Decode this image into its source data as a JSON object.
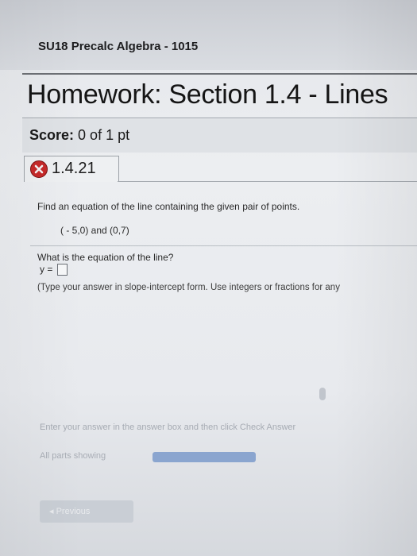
{
  "header": {
    "course_title": "SU18 Precalc Algebra - 1015",
    "homework_title": "Homework: Section 1.4 - Lines"
  },
  "score": {
    "label": "Score:",
    "value": "0 of 1 pt"
  },
  "question": {
    "status_icon": "x-icon",
    "status_color": "#c62a2a",
    "number": "1.4.21",
    "prompt": "Find an equation of the line containing the given pair of points.",
    "points": "( - 5,0) and (0,7)",
    "ask": "What is the equation of the line?",
    "answer_label": "y =",
    "answer_value": "",
    "hint": "(Type your answer in slope-intercept form. Use integers or fractions for any"
  },
  "footer": {
    "enter_hint": "Enter your answer in the answer box and then click Check Answer",
    "parts_label": "All parts showing",
    "parts_progress": 1.0,
    "previous_label": "◂ Previous"
  }
}
